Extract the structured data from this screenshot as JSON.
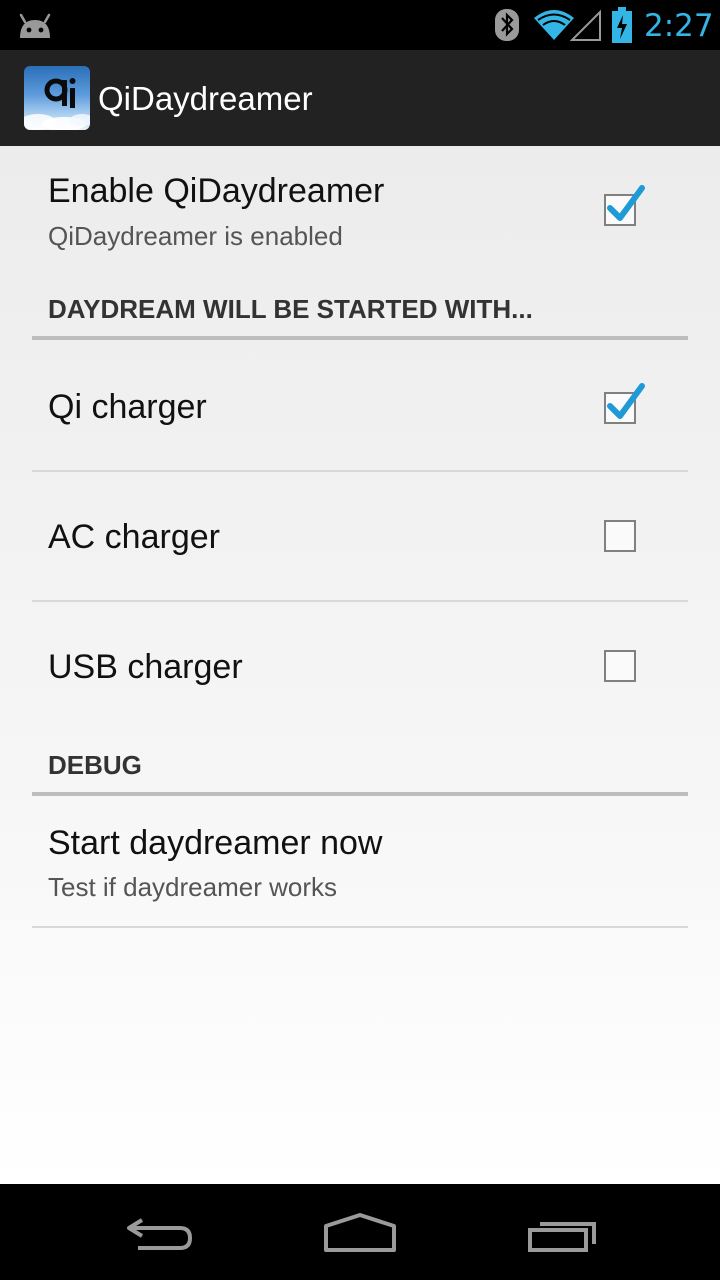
{
  "status_bar": {
    "time": "2:27",
    "icons": [
      "android-icon",
      "bluetooth-icon",
      "wifi-icon",
      "signal-icon",
      "battery-charging-icon"
    ]
  },
  "action_bar": {
    "app_icon": "qi-app-icon",
    "title": "QiDaydreamer"
  },
  "preferences": {
    "enable": {
      "title": "Enable QiDaydreamer",
      "summary": "QiDaydreamer is enabled",
      "checked": true
    },
    "start_category": {
      "header": "DAYDREAM WILL BE STARTED WITH..."
    },
    "qi_charger": {
      "title": "Qi charger",
      "checked": true
    },
    "ac_charger": {
      "title": "AC charger",
      "checked": false
    },
    "usb_charger": {
      "title": "USB charger",
      "checked": false
    },
    "debug_category": {
      "header": "DEBUG"
    },
    "start_now": {
      "title": "Start daydreamer now",
      "summary": "Test if daydreamer works"
    }
  },
  "colors": {
    "accent": "#33b5e5",
    "action_bar": "#222222",
    "check": "#1e9ad6"
  },
  "nav_bar": {
    "icons": [
      "back-icon",
      "home-icon",
      "recent-apps-icon"
    ]
  }
}
